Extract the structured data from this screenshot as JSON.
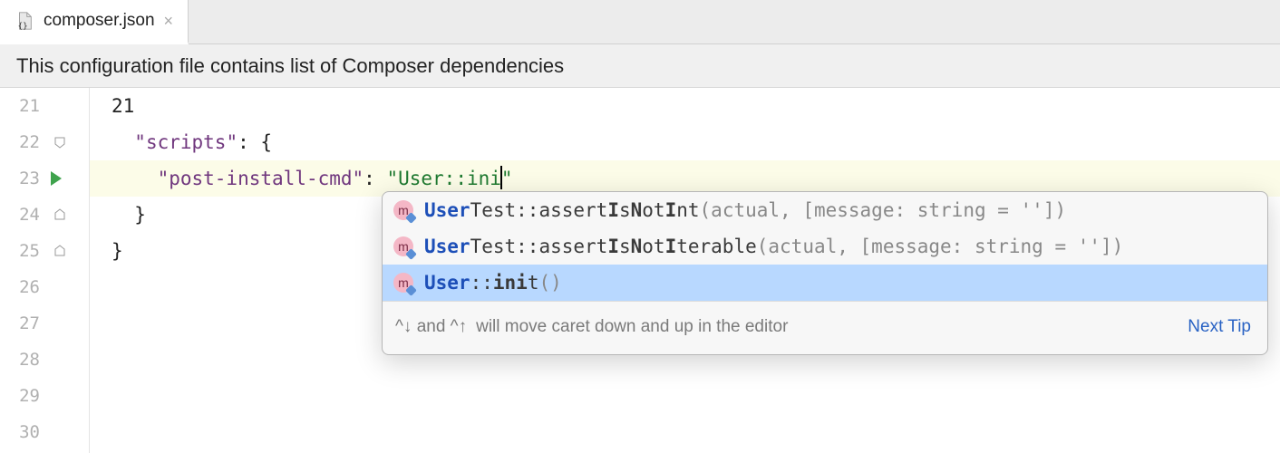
{
  "tab": {
    "filename": "composer.json"
  },
  "banner": {
    "text": "This configuration file contains list of Composer dependencies"
  },
  "gutter": {
    "lines": [
      "21",
      "22",
      "23",
      "24",
      "25",
      "26",
      "27",
      "28",
      "29",
      "30"
    ]
  },
  "code": {
    "line21_brace": "21",
    "line22_indent": "  ",
    "line22_key": "\"scripts\"",
    "line22_after": ": {",
    "line23_indent": "    ",
    "line23_key": "\"post-install-cmd\"",
    "line23_mid": ": ",
    "line23_val_open": "\"",
    "line23_val_text": "User::ini",
    "line23_val_close": "\"",
    "line24_indent": "  ",
    "line24_brace": "}",
    "line25_brace": "}"
  },
  "popup": {
    "items": [
      {
        "class": "User",
        "classTail": "Test",
        "sep": "::",
        "method_pre": "assert",
        "method_hl1": "I",
        "method_mid1": "s",
        "method_hl2": "N",
        "method_mid2": "ot",
        "method_hl3": "I",
        "method_mid3": "nt",
        "args": "(actual, [message: string = ''])"
      },
      {
        "class": "User",
        "classTail": "Test",
        "sep": "::",
        "method_pre": "assert",
        "method_hl1": "I",
        "method_mid1": "s",
        "method_hl2": "N",
        "method_mid2": "ot",
        "method_hl3": "I",
        "method_mid3": "terable",
        "args": "(actual, [message: string = ''])"
      },
      {
        "class": "User",
        "classTail": "",
        "sep": "::",
        "method_pre": "",
        "method_hl1": "ini",
        "method_mid1": "t",
        "method_hl2": "",
        "method_mid2": "",
        "method_hl3": "",
        "method_mid3": "",
        "args": "()"
      }
    ],
    "hint_keys": "^↓ and ^↑",
    "hint_text": " will move caret down and up in the editor",
    "hint_link": "Next Tip"
  }
}
